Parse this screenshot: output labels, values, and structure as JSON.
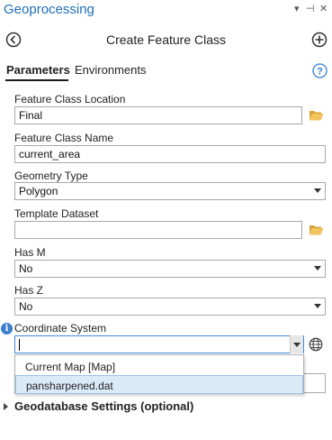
{
  "window": {
    "title": "Geoprocessing",
    "controls": [
      "▾",
      "⊣",
      "✕"
    ]
  },
  "tool": {
    "title": "Create Feature Class"
  },
  "tabs": [
    {
      "label": "Parameters",
      "active": true
    },
    {
      "label": "Environments",
      "active": false
    }
  ],
  "params": {
    "location": {
      "label": "Feature Class Location",
      "value": "Final"
    },
    "name": {
      "label": "Feature Class Name",
      "value": "current_area"
    },
    "geometry": {
      "label": "Geometry Type",
      "value": "Polygon"
    },
    "template": {
      "label": "Template Dataset",
      "value": ""
    },
    "has_m": {
      "label": "Has M",
      "value": "No"
    },
    "has_z": {
      "label": "Has Z",
      "value": "No"
    },
    "coord": {
      "label": "Coordinate System",
      "value": ""
    }
  },
  "dropdown": {
    "options": [
      "Current Map [Map]",
      "pansharpened.dat"
    ],
    "highlighted": "pansharpened.dat"
  },
  "sections": {
    "geodatabase": "Geodatabase Settings (optional)"
  },
  "colors": {
    "accent": "#1e6fb5",
    "highlight": "#dbeaf7",
    "folder": "#e8b648"
  }
}
